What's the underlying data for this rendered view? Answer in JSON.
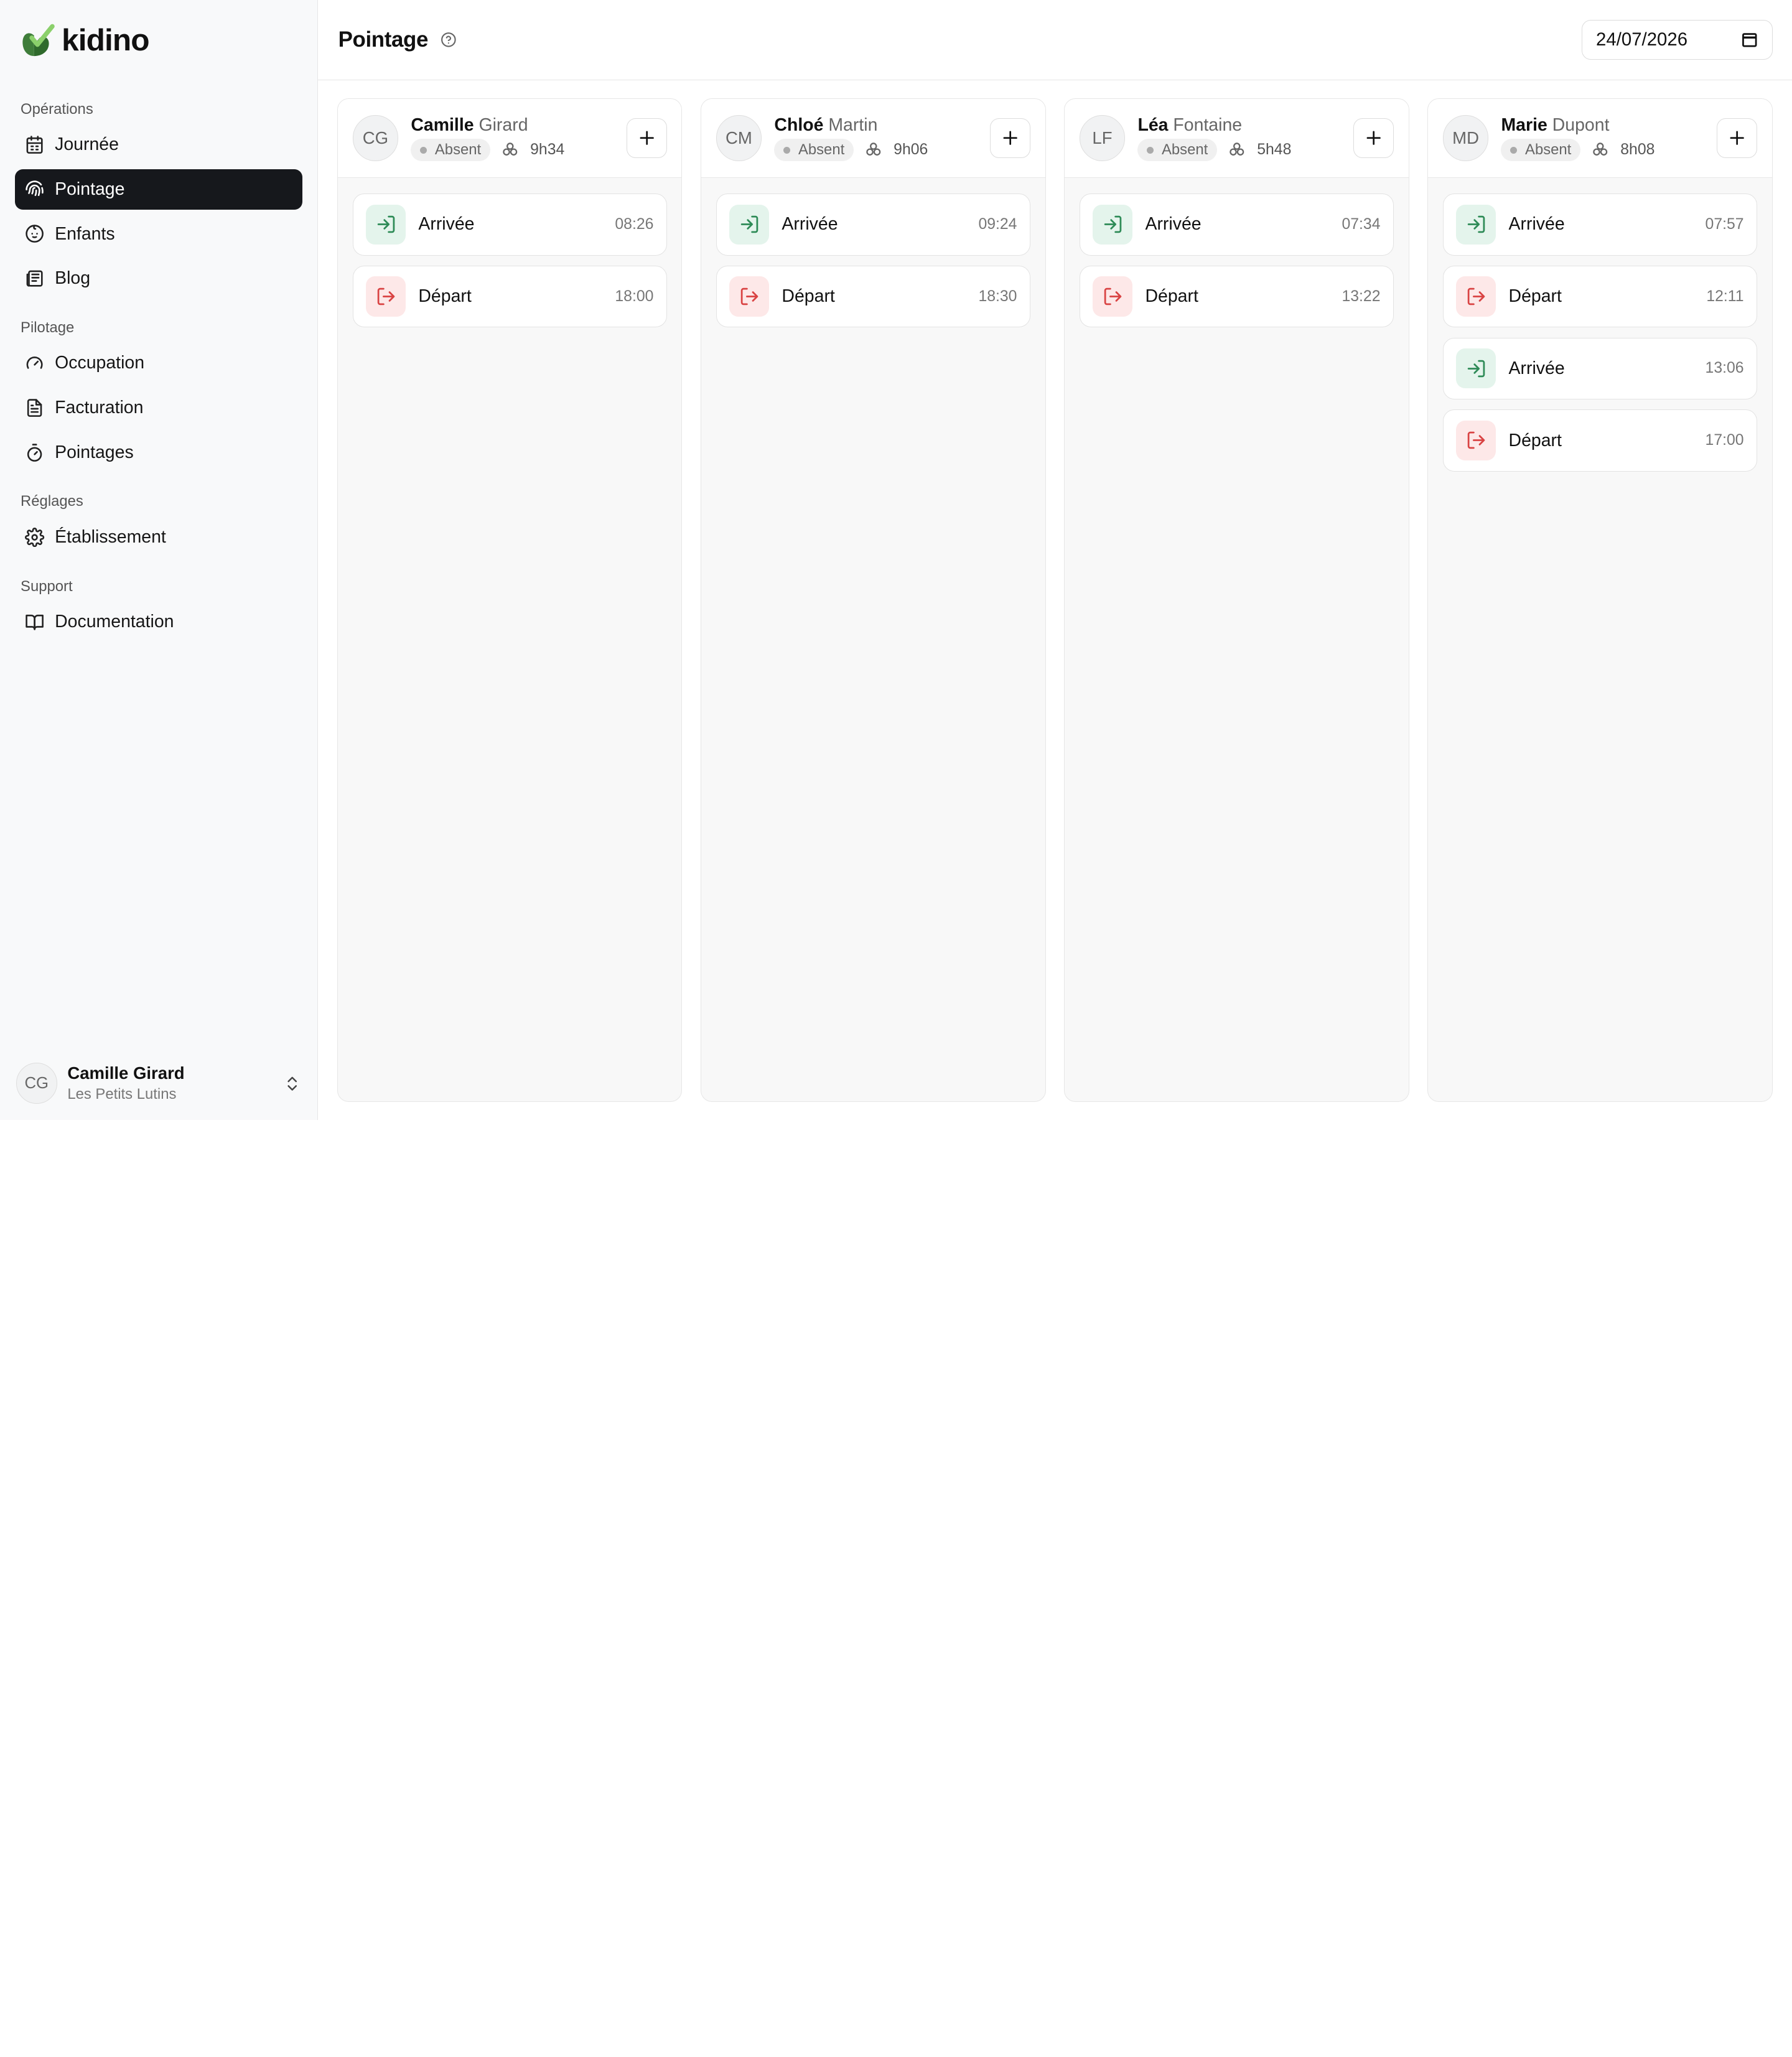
{
  "app": {
    "name": "kidino"
  },
  "sidebar": {
    "sections": [
      {
        "title": "Opérations",
        "items": [
          {
            "label": "Journée",
            "icon": "calendar-icon"
          },
          {
            "label": "Pointage",
            "icon": "fingerprint-icon",
            "active": true
          },
          {
            "label": "Enfants",
            "icon": "baby-icon"
          },
          {
            "label": "Blog",
            "icon": "newspaper-icon"
          }
        ]
      },
      {
        "title": "Pilotage",
        "items": [
          {
            "label": "Occupation",
            "icon": "gauge-icon"
          },
          {
            "label": "Facturation",
            "icon": "file-text-icon"
          },
          {
            "label": "Pointages",
            "icon": "timer-icon"
          }
        ]
      },
      {
        "title": "Réglages",
        "items": [
          {
            "label": "Établissement",
            "icon": "gear-icon"
          }
        ]
      },
      {
        "title": "Support",
        "items": [
          {
            "label": "Documentation",
            "icon": "book-icon"
          }
        ]
      }
    ],
    "user": {
      "initials": "CG",
      "name": "Camille Girard",
      "org": "Les Petits Lutins"
    }
  },
  "header": {
    "title": "Pointage",
    "date": "24/07/2026"
  },
  "colors": {
    "accent": "#16181c",
    "in_bg": "#e4f4ec",
    "in_fg": "#2e8b57",
    "out_bg": "#fde8e8",
    "out_fg": "#d94343"
  },
  "staff": [
    {
      "initials": "CG",
      "first": "Camille",
      "last": "Girard",
      "status": "Absent",
      "hours": "9h34",
      "events": [
        {
          "type": "in",
          "label": "Arrivée",
          "time": "08:26"
        },
        {
          "type": "out",
          "label": "Départ",
          "time": "18:00"
        }
      ]
    },
    {
      "initials": "CM",
      "first": "Chloé",
      "last": "Martin",
      "status": "Absent",
      "hours": "9h06",
      "events": [
        {
          "type": "in",
          "label": "Arrivée",
          "time": "09:24"
        },
        {
          "type": "out",
          "label": "Départ",
          "time": "18:30"
        }
      ]
    },
    {
      "initials": "LF",
      "first": "Léa",
      "last": "Fontaine",
      "status": "Absent",
      "hours": "5h48",
      "events": [
        {
          "type": "in",
          "label": "Arrivée",
          "time": "07:34"
        },
        {
          "type": "out",
          "label": "Départ",
          "time": "13:22"
        }
      ]
    },
    {
      "initials": "MD",
      "first": "Marie",
      "last": "Dupont",
      "status": "Absent",
      "hours": "8h08",
      "events": [
        {
          "type": "in",
          "label": "Arrivée",
          "time": "07:57"
        },
        {
          "type": "out",
          "label": "Départ",
          "time": "12:11"
        },
        {
          "type": "in",
          "label": "Arrivée",
          "time": "13:06"
        },
        {
          "type": "out",
          "label": "Départ",
          "time": "17:00"
        }
      ]
    }
  ]
}
